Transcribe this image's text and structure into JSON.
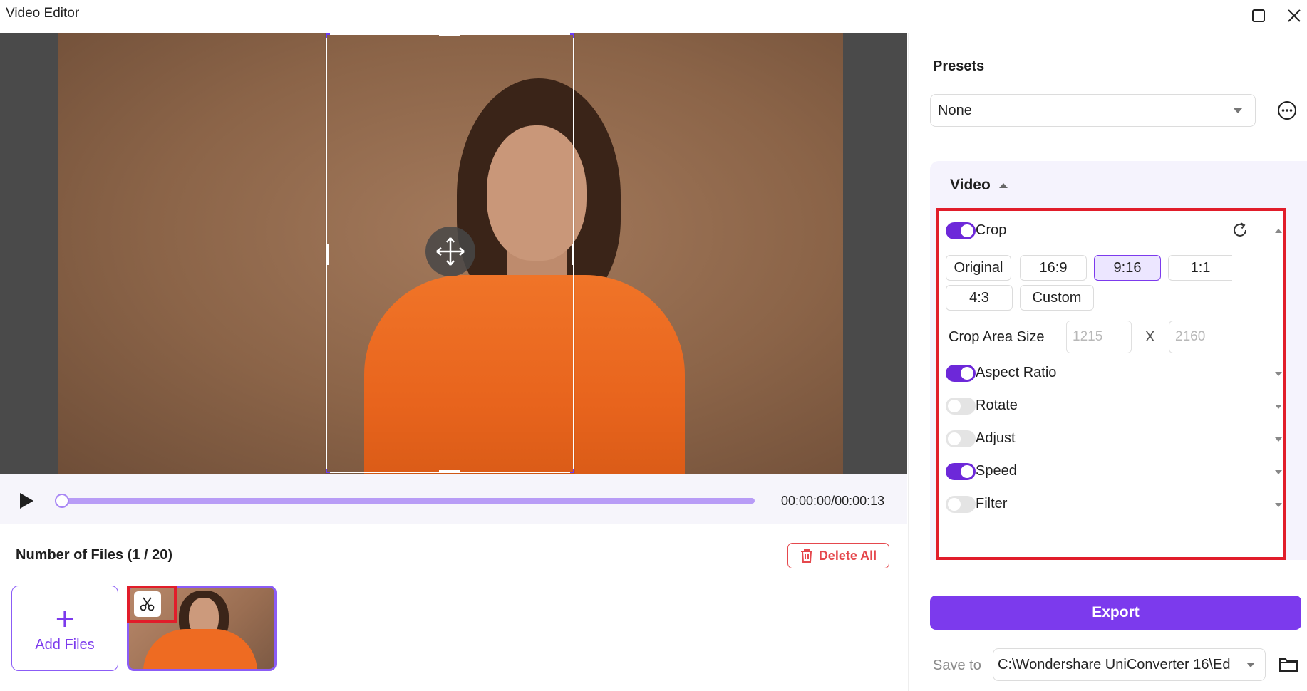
{
  "window": {
    "title": "Video Editor"
  },
  "playback": {
    "timecode": "00:00:00/00:00:13",
    "progress": 0.0
  },
  "files": {
    "title": "Number of Files (1 / 20)",
    "delete_all_label": "Delete All",
    "add_files_label": "Add Files"
  },
  "presets": {
    "title": "Presets",
    "selected": "None"
  },
  "video": {
    "title": "Video",
    "crop": {
      "label": "Crop",
      "enabled": true,
      "ratios": [
        "Original",
        "16:9",
        "9:16",
        "1:1",
        "4:3",
        "Custom"
      ],
      "selected_ratio": "9:16",
      "area_size_label": "Crop Area Size",
      "width_placeholder": "1215",
      "height_placeholder": "2160",
      "separator": "X"
    },
    "options": [
      {
        "label": "Aspect Ratio",
        "enabled": true
      },
      {
        "label": "Rotate",
        "enabled": false
      },
      {
        "label": "Adjust",
        "enabled": false
      },
      {
        "label": "Speed",
        "enabled": true
      },
      {
        "label": "Filter",
        "enabled": false
      }
    ]
  },
  "export": {
    "label": "Export"
  },
  "save": {
    "label": "Save to",
    "path": "C:\\Wondershare UniConverter 16\\Ed"
  },
  "colors": {
    "accent": "#7c3aed",
    "highlight": "#e11d2a",
    "danger": "#e5484d"
  }
}
